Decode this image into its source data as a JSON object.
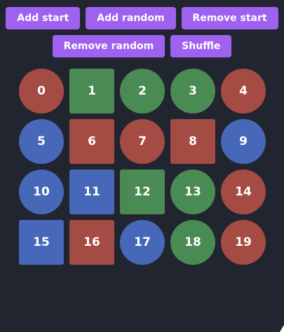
{
  "toolbar": {
    "row1": [
      {
        "name": "add-start-button",
        "label": "Add start"
      },
      {
        "name": "add-random-button",
        "label": "Add random"
      },
      {
        "name": "remove-start-button",
        "label": "Remove start"
      }
    ],
    "row2": [
      {
        "name": "remove-random-button",
        "label": "Remove random"
      },
      {
        "name": "shuffle-button",
        "label": "Shuffle"
      }
    ]
  },
  "colors": {
    "red": "#a44c44",
    "green": "#4a8a53",
    "blue": "#4768b8",
    "button": "#9f62f0",
    "background": "#21252f"
  },
  "items": [
    {
      "label": "0",
      "shape": "circle",
      "color": "red"
    },
    {
      "label": "1",
      "shape": "square",
      "color": "green"
    },
    {
      "label": "2",
      "shape": "circle",
      "color": "green"
    },
    {
      "label": "3",
      "shape": "circle",
      "color": "green"
    },
    {
      "label": "4",
      "shape": "circle",
      "color": "red"
    },
    {
      "label": "5",
      "shape": "circle",
      "color": "blue"
    },
    {
      "label": "6",
      "shape": "square",
      "color": "red"
    },
    {
      "label": "7",
      "shape": "circle",
      "color": "red"
    },
    {
      "label": "8",
      "shape": "square",
      "color": "red"
    },
    {
      "label": "9",
      "shape": "circle",
      "color": "blue"
    },
    {
      "label": "10",
      "shape": "circle",
      "color": "blue"
    },
    {
      "label": "11",
      "shape": "square",
      "color": "blue"
    },
    {
      "label": "12",
      "shape": "square",
      "color": "green"
    },
    {
      "label": "13",
      "shape": "circle",
      "color": "green"
    },
    {
      "label": "14",
      "shape": "circle",
      "color": "red"
    },
    {
      "label": "15",
      "shape": "square",
      "color": "blue"
    },
    {
      "label": "16",
      "shape": "square",
      "color": "red"
    },
    {
      "label": "17",
      "shape": "circle",
      "color": "blue"
    },
    {
      "label": "18",
      "shape": "circle",
      "color": "green"
    },
    {
      "label": "19",
      "shape": "circle",
      "color": "red"
    }
  ]
}
